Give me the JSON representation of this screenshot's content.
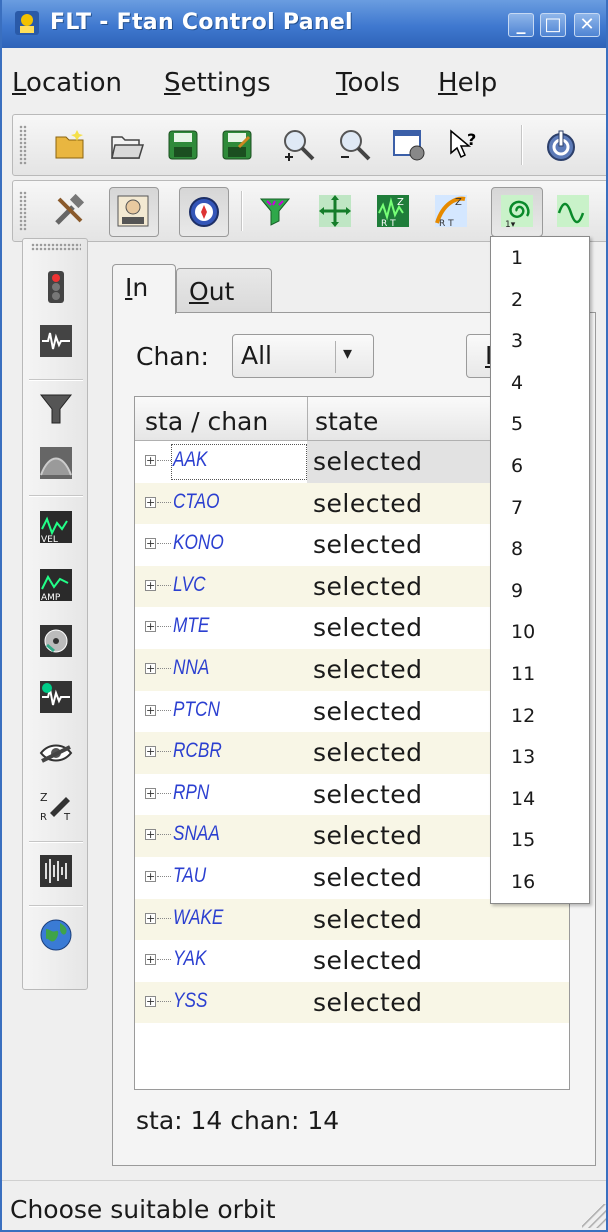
{
  "window": {
    "title": "FLT - Ftan Control Panel",
    "minimize": "_",
    "maximize": "□",
    "close": "✕"
  },
  "menubar": {
    "items": [
      {
        "label_rest": "ocation",
        "mnemonic": "L"
      },
      {
        "label_rest": "ettings",
        "mnemonic": "S"
      },
      {
        "label_rest": "ools",
        "mnemonic": "T"
      },
      {
        "label_rest": "elp",
        "mnemonic": "H"
      }
    ]
  },
  "toolbar1": {
    "icons": [
      "new-folder-icon",
      "open-folder-icon",
      "save-icon",
      "save-as-icon",
      "zoom-in-icon",
      "zoom-out-icon",
      "settings-window-icon",
      "whats-this-icon",
      "power-icon"
    ]
  },
  "toolbar2": {
    "icons": [
      "tools-icon",
      "operator-icon",
      "compass-icon",
      "filter-green-icon",
      "move-axes-icon",
      "zrt-rotate-icon",
      "zrt-curve-icon",
      "orbit-select-icon",
      "sine-wave-icon"
    ]
  },
  "left_toolbar": {
    "icons": [
      "traffic-light-icon",
      "waveform-icon",
      "funnel-icon",
      "envelope-icon",
      "velocity-icon",
      "amplitude-icon",
      "disk-icon",
      "waveform-gear-icon",
      "eye-icon",
      "zrt-pen-icon",
      "sound-bars-icon",
      "globe-icon"
    ],
    "vel_text": "VEL",
    "amp_text": "AMP"
  },
  "tabs": {
    "in_mnemonic": "I",
    "in_rest": "n",
    "out_mnemonic": "O",
    "out_rest": "ut"
  },
  "channel_filter": {
    "label": "Chan:",
    "value": "All",
    "arrow": "▾"
  },
  "right_button": {
    "label": "I"
  },
  "table": {
    "headers": [
      "sta / chan",
      "state"
    ],
    "rows": [
      {
        "sta": "AAK",
        "state": "selected"
      },
      {
        "sta": "CTAO",
        "state": "selected"
      },
      {
        "sta": "KONO",
        "state": "selected"
      },
      {
        "sta": "LVC",
        "state": "selected"
      },
      {
        "sta": "MTE",
        "state": "selected"
      },
      {
        "sta": "NNA",
        "state": "selected"
      },
      {
        "sta": "PTCN",
        "state": "selected"
      },
      {
        "sta": "RCBR",
        "state": "selected"
      },
      {
        "sta": "RPN",
        "state": "selected"
      },
      {
        "sta": "SNAA",
        "state": "selected"
      },
      {
        "sta": "TAU",
        "state": "selected"
      },
      {
        "sta": "WAKE",
        "state": "selected"
      },
      {
        "sta": "YAK",
        "state": "selected"
      },
      {
        "sta": "YSS",
        "state": "selected"
      }
    ]
  },
  "counts": "sta: 14 chan: 14",
  "status": "Choose suitable orbit",
  "orbit_dropdown": {
    "items": [
      "1",
      "2",
      "3",
      "4",
      "5",
      "6",
      "7",
      "8",
      "9",
      "10",
      "11",
      "12",
      "13",
      "14",
      "15",
      "16"
    ]
  },
  "colors": {
    "titlebar": "#3f78cf",
    "station_text": "#2b3fd0",
    "alt_row": "#f8f6e6"
  }
}
